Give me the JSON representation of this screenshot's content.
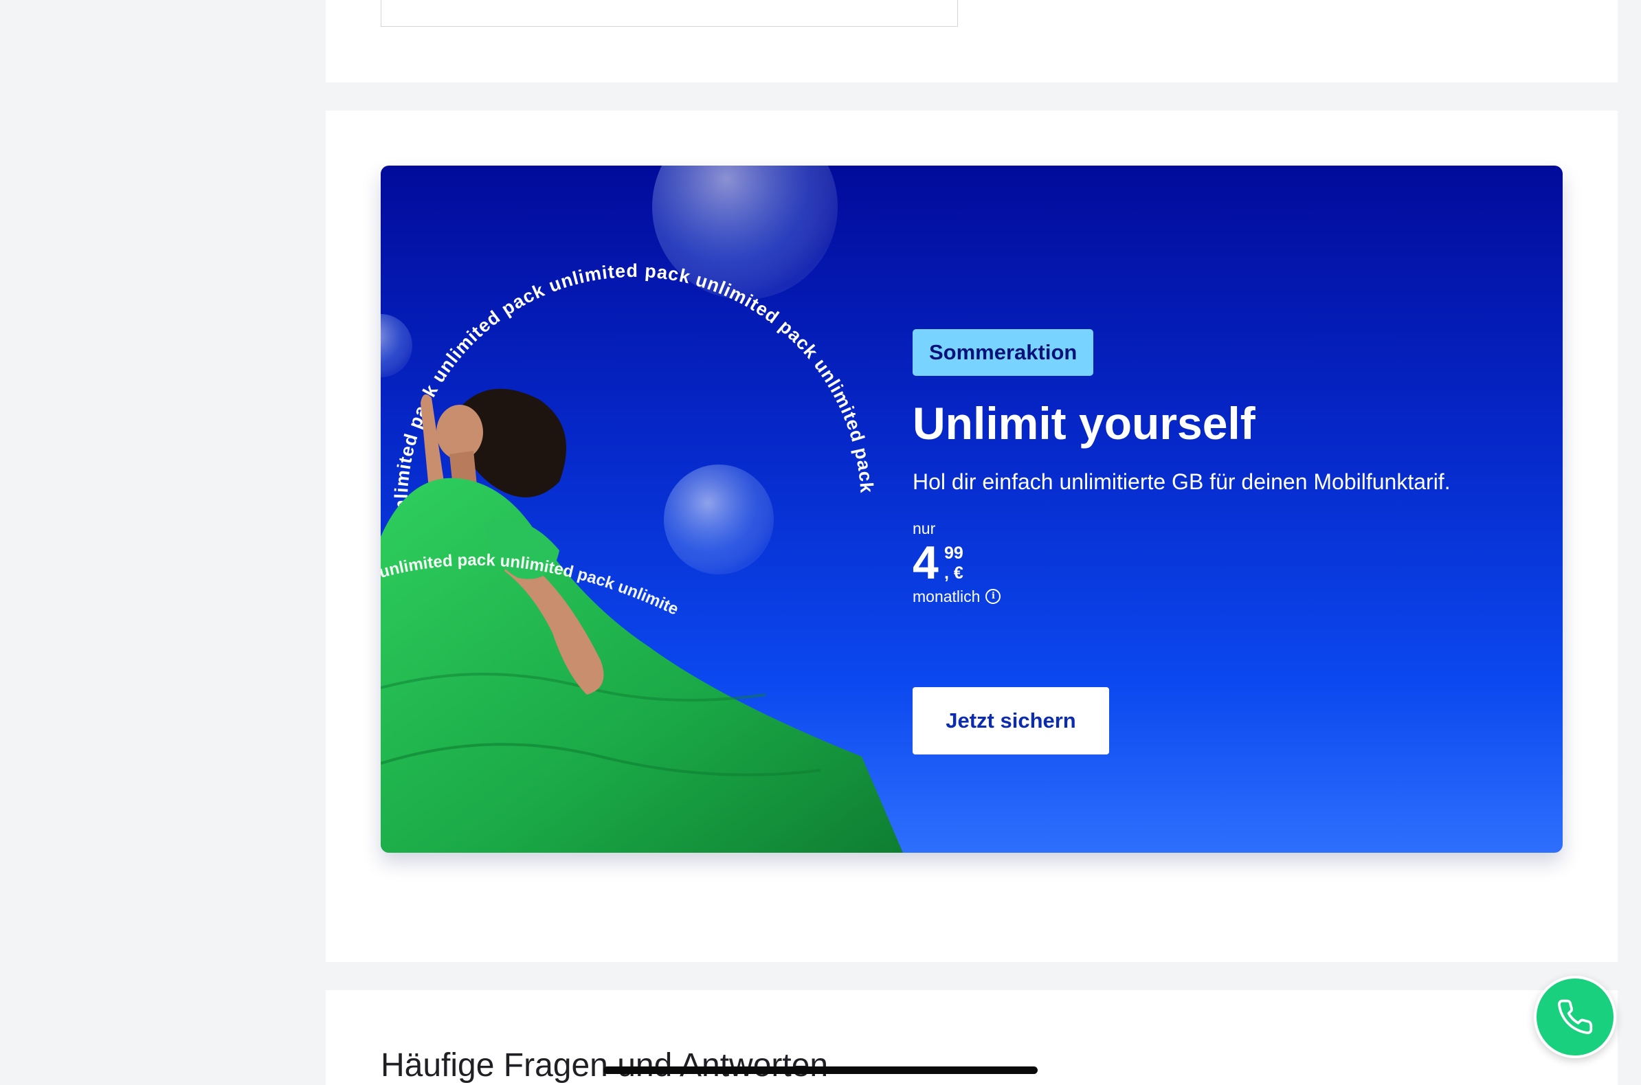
{
  "promo": {
    "badge": "Sommeraktion",
    "headline": "Unlimit yourself",
    "subline": "Hol dir einfach unlimitierte GB für deinen Mobilfunktarif.",
    "price": {
      "prefix": "nur",
      "main": "4",
      "cents": "99",
      "currency": ", €",
      "suffix": "monatlich",
      "info_icon": "info-icon"
    },
    "cta_label": "Jetzt sichern",
    "image": {
      "arc_text": "unlimited pack unlimited pack unlimited pack unlimited pack unlimited pack",
      "band_text": "unlimited pack unlimited pack unlimited",
      "description": "woman-in-green-dress-icon"
    },
    "colors": {
      "banner_top": "#020b9b",
      "banner_bottom": "#2e6ffd",
      "badge_bg": "#78d3ff",
      "badge_text": "#06127a",
      "dress": "#1fb44f"
    }
  },
  "faq": {
    "title": "Häufige Fragen und Antworten"
  },
  "fab": {
    "icon": "phone-icon",
    "color": "#18d07e"
  }
}
